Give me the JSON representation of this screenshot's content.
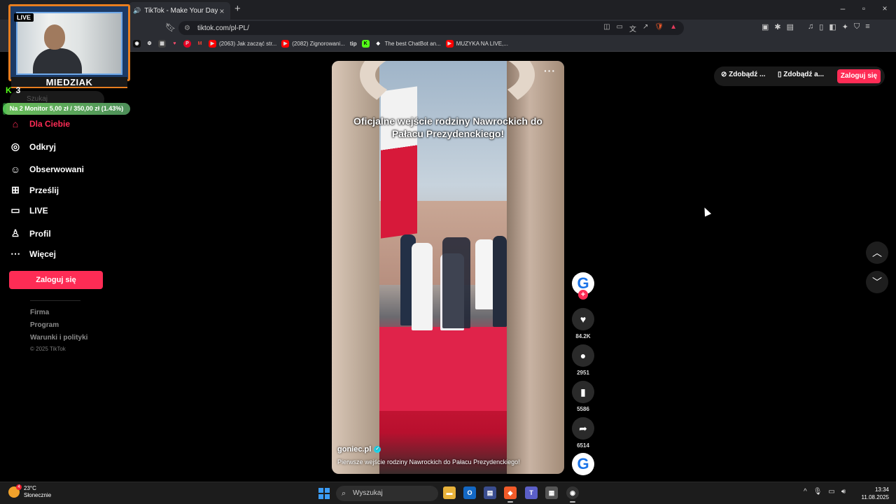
{
  "browser": {
    "tab_title": "TikTok - Make Your Day",
    "url": "tiktok.com/pl-PL/",
    "bookmarks": [
      {
        "label": "(2063) Jak zacząć str...",
        "icon_color": "#ff0000"
      },
      {
        "label": "(2082) Zignorowani...",
        "icon_color": "#ff0000"
      },
      {
        "label": "tip",
        "icon_color": "#222222"
      },
      {
        "label": "The best ChatBot an...",
        "icon_color": "#ffffff"
      },
      {
        "label": "MUZYKA NA LIVE,...",
        "icon_color": "#ff0000"
      }
    ]
  },
  "stream_overlay": {
    "live_tag": "LIVE",
    "streamer_name": "MIEDZIAK",
    "kick_count": "3",
    "goal_text": "Na 2 Monitor 5,00 zł / 350,00 zł (1.43%)",
    "goal_progress": 0.0143,
    "accent_color": "#e77d1f"
  },
  "sidebar": {
    "search_placeholder": "Szukaj",
    "items": [
      {
        "label": "Dla Ciebie",
        "icon": "home-icon",
        "active": true
      },
      {
        "label": "Odkryj",
        "icon": "compass-icon",
        "active": false
      },
      {
        "label": "Obserwowani",
        "icon": "following-icon",
        "active": false
      },
      {
        "label": "Prześlij",
        "icon": "upload-icon",
        "active": false
      },
      {
        "label": "LIVE",
        "icon": "live-icon",
        "active": false
      },
      {
        "label": "Profil",
        "icon": "profile-icon",
        "active": false
      },
      {
        "label": "Więcej",
        "icon": "more-icon",
        "active": false
      }
    ],
    "login_label": "Zaloguj się",
    "footer_links": [
      "Firma",
      "Program",
      "Warunki i polityki"
    ],
    "copyright": "© 2025 TikTok"
  },
  "video": {
    "title": "Oficjalne wejście rodziny Nawrockich do Pałacu Prezydenckiego!",
    "author": "goniec.pl",
    "description": "Pierwsze wejście rodziny Nawrockich do Pałacu Prezydenckiego!"
  },
  "actions": {
    "likes": "84.2K",
    "comments": "2951",
    "saves": "5586",
    "shares": "6514"
  },
  "top_right": {
    "btn1": "Zdobądź ...",
    "btn2": "Zdobądź a...",
    "login_label": "Zaloguj się"
  },
  "taskbar": {
    "temperature": "23°C",
    "weather": "Słonecznie",
    "weather_badge": "4",
    "search_placeholder": "Wyszukaj",
    "time": "13:34",
    "date": "11.08.2025"
  },
  "colors": {
    "brand": "#fe2c55",
    "verified": "#20d5ec"
  }
}
